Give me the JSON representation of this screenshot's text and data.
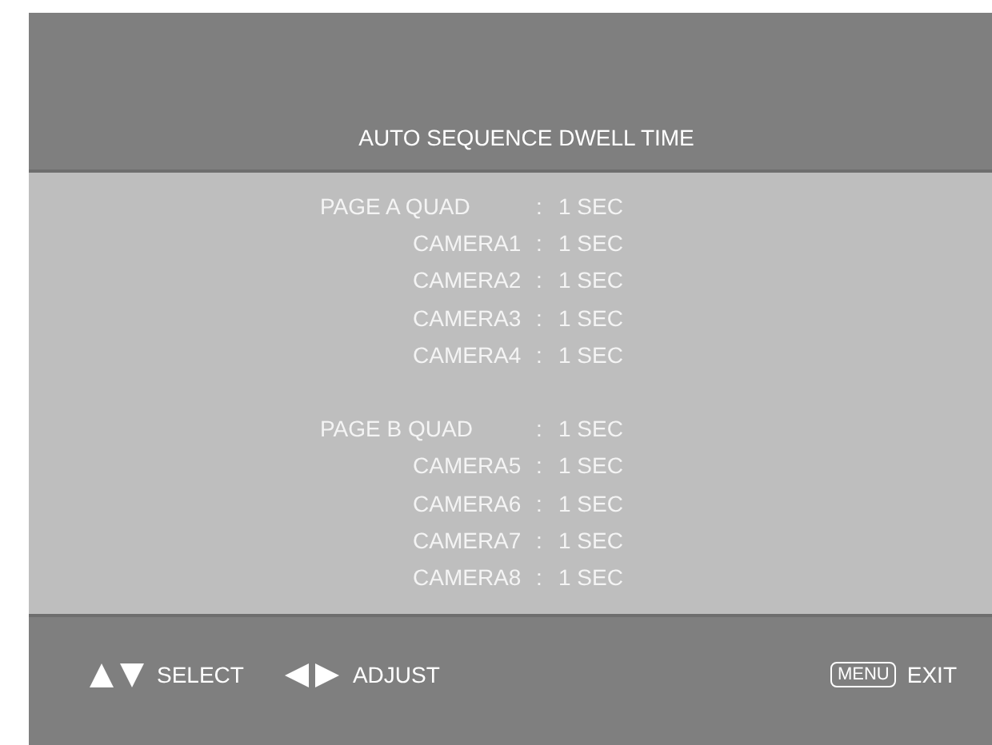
{
  "title": "AUTO SEQUENCE DWELL TIME",
  "groups": [
    {
      "rows": [
        {
          "kind": "page",
          "label": "PAGE A QUAD",
          "separator": ":",
          "value": "1 SEC"
        },
        {
          "kind": "camera",
          "label": "CAMERA1",
          "separator": ":",
          "value": "1 SEC"
        },
        {
          "kind": "camera",
          "label": "CAMERA2",
          "separator": ":",
          "value": "1 SEC"
        },
        {
          "kind": "camera",
          "label": "CAMERA3",
          "separator": ":",
          "value": "1 SEC"
        },
        {
          "kind": "camera",
          "label": "CAMERA4",
          "separator": ":",
          "value": "1 SEC"
        }
      ]
    },
    {
      "rows": [
        {
          "kind": "page",
          "label": "PAGE B QUAD",
          "separator": ":",
          "value": "1 SEC"
        },
        {
          "kind": "camera",
          "label": "CAMERA5",
          "separator": ":",
          "value": "1 SEC"
        },
        {
          "kind": "camera",
          "label": "CAMERA6",
          "separator": ":",
          "value": "1 SEC"
        },
        {
          "kind": "camera",
          "label": "CAMERA7",
          "separator": ":",
          "value": "1 SEC"
        },
        {
          "kind": "camera",
          "label": "CAMERA8",
          "separator": ":",
          "value": "1 SEC"
        }
      ]
    }
  ],
  "footer": {
    "hints": [
      {
        "kind": "updown",
        "label": "SELECT"
      },
      {
        "kind": "leftright",
        "label": "ADJUST"
      }
    ],
    "exit": {
      "key": "MENU",
      "label": "EXIT"
    }
  }
}
